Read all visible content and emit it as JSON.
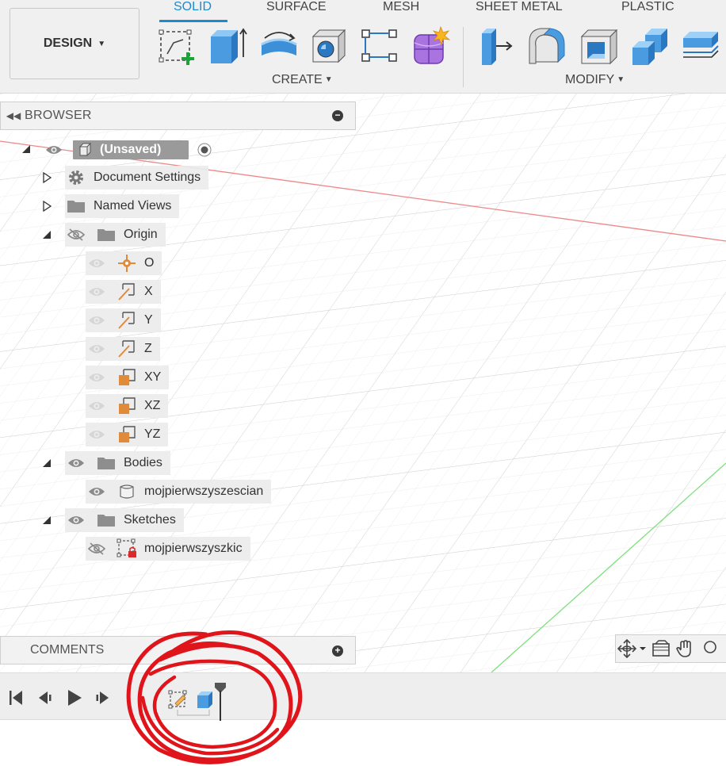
{
  "toolbar": {
    "workspace_label": "DESIGN",
    "tabs": [
      "SOLID",
      "SURFACE",
      "MESH",
      "SHEET METAL",
      "PLASTIC"
    ],
    "active_tab": "SOLID",
    "groups": {
      "create": "CREATE",
      "modify": "MODIFY"
    },
    "create_tools": [
      "create-sketch",
      "extrude",
      "revolve",
      "hole",
      "form",
      "derive"
    ],
    "modify_tools": [
      "press-pull",
      "fillet",
      "shell",
      "combine",
      "offset-face"
    ]
  },
  "browser": {
    "title": "BROWSER",
    "root": "(Unsaved)",
    "items": {
      "document_settings": "Document Settings",
      "named_views": "Named Views",
      "origin": "Origin",
      "origin_o": "O",
      "origin_x": "X",
      "origin_y": "Y",
      "origin_z": "Z",
      "origin_xy": "XY",
      "origin_xz": "XZ",
      "origin_yz": "YZ",
      "bodies": "Bodies",
      "body_1": "mojpierwszyszescian",
      "sketches": "Sketches",
      "sketch_1": "mojpierwszyszkic"
    }
  },
  "comments": {
    "title": "COMMENTS"
  },
  "timeline": {
    "controls": [
      "go-to-start",
      "step-back",
      "play",
      "step-forward"
    ],
    "features": [
      "sketch",
      "extrude"
    ]
  },
  "colors": {
    "accent": "#1a8bd1",
    "red_axis": "#ee8888",
    "green_axis": "#7ee07e",
    "origin_orange": "#e08a3c",
    "annotation_red": "#e0141b"
  }
}
